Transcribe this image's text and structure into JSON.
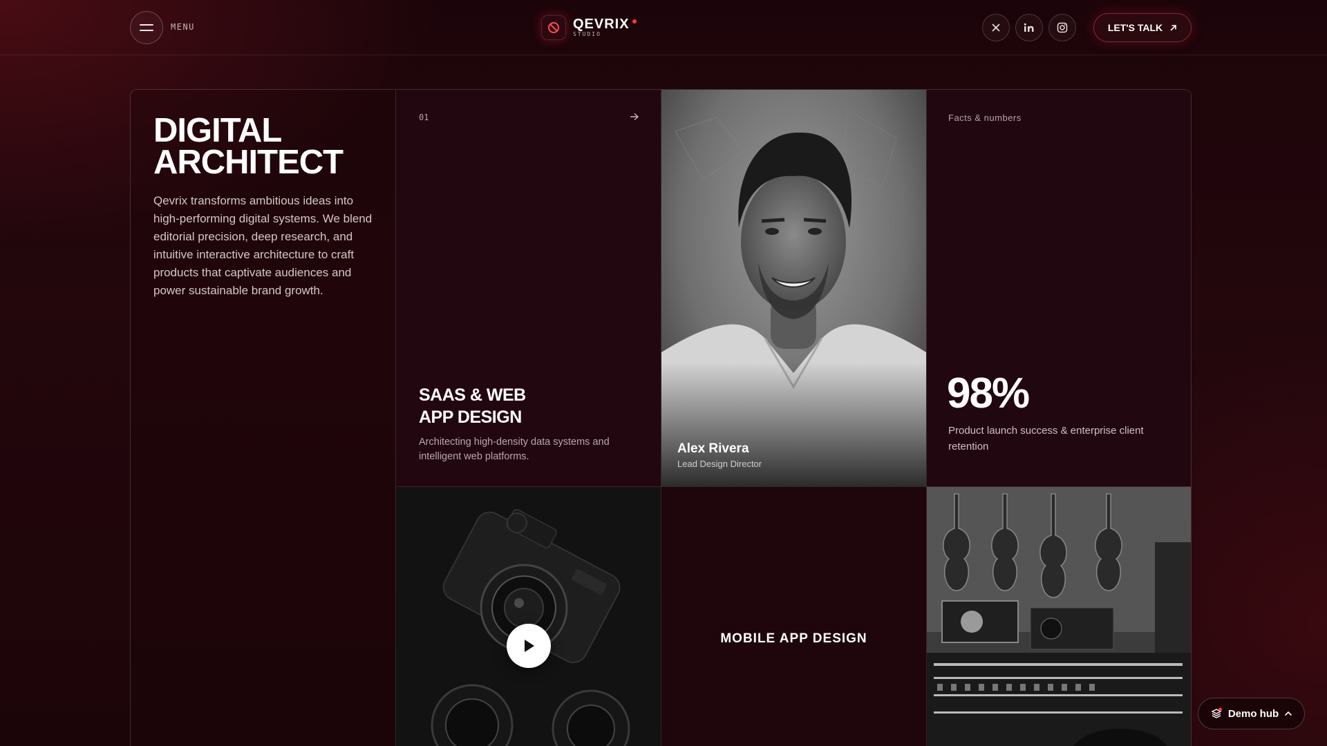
{
  "header": {
    "menu_label": "MENU",
    "logo_name": "QEVRIX",
    "logo_sub": "STUDIO",
    "cta_label": "LET'S TALK",
    "socials": [
      "x-icon",
      "linkedin-icon",
      "instagram-icon"
    ]
  },
  "intro": {
    "title_line1": "DIGITAL",
    "title_line2": "ARCHITECT",
    "body": "Qevrix transforms ambitious ideas into high-performing digital systems. We blend editorial precision, deep research, and intuitive interactive architecture to craft products that captivate audiences and power sustainable brand growth."
  },
  "service": {
    "number": "01",
    "title_line1": "SAAS & WEB",
    "title_line2": "APP DESIGN",
    "description": "Architecting high-density data systems and intelligent web platforms."
  },
  "profile": {
    "name": "Alex Rivera",
    "role": "Lead Design Director"
  },
  "stat": {
    "label": "Facts & numbers",
    "value": "98%",
    "description": "Product launch success & enterprise client retention"
  },
  "mobile": {
    "title": "MOBILE APP DESIGN"
  },
  "demo_hub": {
    "label": "Demo hub"
  },
  "colors": {
    "background": "#1c050a",
    "accent": "#ff3b3b",
    "text": "#ffffff"
  }
}
